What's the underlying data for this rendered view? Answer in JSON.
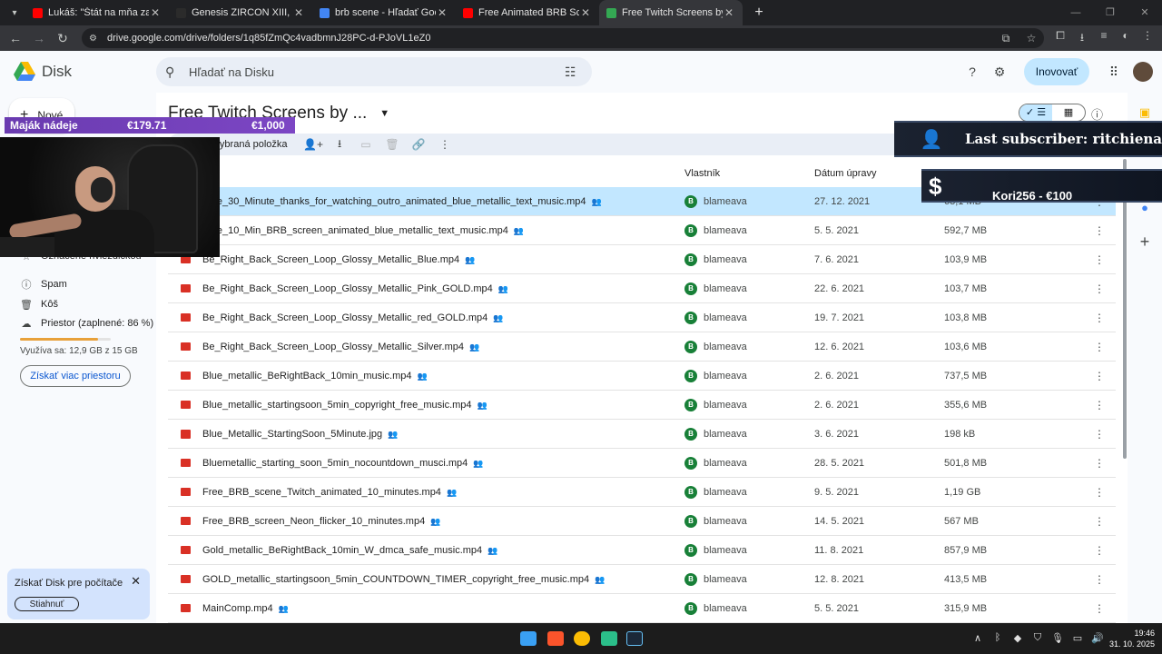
{
  "browser": {
    "tabs": [
      {
        "title": "Lukáš: \"Štát na mňa zabudol a ...",
        "favicon": "youtube-icon",
        "color": "#ff0000",
        "active": false
      },
      {
        "title": "Genesis ZIRCON XIII, čierna za ...",
        "favicon": "shop-icon",
        "color": "#2b2b2b",
        "active": false
      },
      {
        "title": "brb scene - Hľadať Googlom",
        "favicon": "google-icon",
        "color": "#4285f4",
        "active": false
      },
      {
        "title": "Free Animated BRB Screen For ...",
        "favicon": "youtube-icon",
        "color": "#ff0000",
        "active": false
      },
      {
        "title": "Free Twitch Screens by BlameA...",
        "favicon": "drive-icon",
        "color": "#34a853",
        "active": true
      }
    ],
    "url": "drive.google.com/drive/folders/1q85fZmQc4vadbmnJ28PC-d-PJoVL1eZ0"
  },
  "drive": {
    "logo_text": "Disk",
    "search_placeholder": "Hľadať na Disku",
    "upgrade_label": "Inovovať",
    "new_label": "Nové",
    "folder_title": "Free Twitch Screens by ...",
    "selection_label": "Vybraná položka",
    "sidebar": {
      "partial_item": "Označené hviezdičkou",
      "items": [
        "Spam",
        "Kôš",
        "Priestor (zaplnené: 86 %)"
      ],
      "storage_fraction": 0.86,
      "storage_text": "Využíva sa: 12,9 GB z 15 GB",
      "more_storage": "Získať viac priestoru",
      "promo_text": "Získať Disk pre počítače",
      "promo_button": "Stiahnuť"
    },
    "columns": {
      "owner": "Vlastník",
      "modified": "Dátum úpravy"
    },
    "files": [
      {
        "name": "Blue_30_Minute_thanks_for_watching_outro_animated_blue_metallic_text_music.mp4",
        "type": "video",
        "owner": "blameava",
        "date": "27. 12. 2021",
        "size": "63,1 MB",
        "selected": true
      },
      {
        "name": "Blue_10_Min_BRB_screen_animated_blue_metallic_text_music.mp4",
        "type": "video",
        "owner": "blameava",
        "date": "5. 5. 2021",
        "size": "592,7 MB"
      },
      {
        "name": "Be_Right_Back_Screen_Loop_Glossy_Metallic_Blue.mp4",
        "type": "video",
        "owner": "blameava",
        "date": "7. 6. 2021",
        "size": "103,9 MB"
      },
      {
        "name": "Be_Right_Back_Screen_Loop_Glossy_Metallic_Pink_GOLD.mp4",
        "type": "video",
        "owner": "blameava",
        "date": "22. 6. 2021",
        "size": "103,7 MB"
      },
      {
        "name": "Be_Right_Back_Screen_Loop_Glossy_Metallic_red_GOLD.mp4",
        "type": "video",
        "owner": "blameava",
        "date": "19. 7. 2021",
        "size": "103,8 MB"
      },
      {
        "name": "Be_Right_Back_Screen_Loop_Glossy_Metallic_Silver.mp4",
        "type": "video",
        "owner": "blameava",
        "date": "12. 6. 2021",
        "size": "103,6 MB"
      },
      {
        "name": "Blue_metallic_BeRightBack_10min_music.mp4",
        "type": "video",
        "owner": "blameava",
        "date": "2. 6. 2021",
        "size": "737,5 MB"
      },
      {
        "name": "Blue_metallic_startingsoon_5min_copyright_free_music.mp4",
        "type": "video",
        "owner": "blameava",
        "date": "2. 6. 2021",
        "size": "355,6 MB"
      },
      {
        "name": "Blue_Metallic_StartingSoon_5Minute.jpg",
        "type": "image",
        "owner": "blameava",
        "date": "3. 6. 2021",
        "size": "198 kB"
      },
      {
        "name": "Bluemetallic_starting_soon_5min_nocountdown_musci.mp4",
        "type": "video",
        "owner": "blameava",
        "date": "28. 5. 2021",
        "size": "501,8 MB"
      },
      {
        "name": "Free_BRB_scene_Twitch_animated_10_minutes.mp4",
        "type": "video",
        "owner": "blameava",
        "date": "9. 5. 2021",
        "size": "1,19 GB"
      },
      {
        "name": "Free_BRB_screen_Neon_flicker_10_minutes.mp4",
        "type": "video",
        "owner": "blameava",
        "date": "14. 5. 2021",
        "size": "567 MB"
      },
      {
        "name": "Gold_metallic_BeRightBack_10min_W_dmca_safe_music.mp4",
        "type": "video",
        "owner": "blameava",
        "date": "11. 8. 2021",
        "size": "857,9 MB"
      },
      {
        "name": "GOLD_metallic_startingsoon_5min_COUNTDOWN_TIMER_copyright_free_music.mp4",
        "type": "video",
        "owner": "blameava",
        "date": "12. 8. 2021",
        "size": "413,5 MB"
      },
      {
        "name": "MainComp.mp4",
        "type": "video",
        "owner": "blameava",
        "date": "5. 5. 2021",
        "size": "315,9 MB"
      }
    ]
  },
  "overlay": {
    "donation_goal_title": "Maják nádeje",
    "donation_current": "€179.71",
    "donation_goal": "€1,000",
    "last_subscriber": "Last subscriber: ritchiena",
    "last_donation": "Kori256 - €100"
  },
  "taskbar": {
    "time": "19:46",
    "date": "31. 10. 2025"
  }
}
